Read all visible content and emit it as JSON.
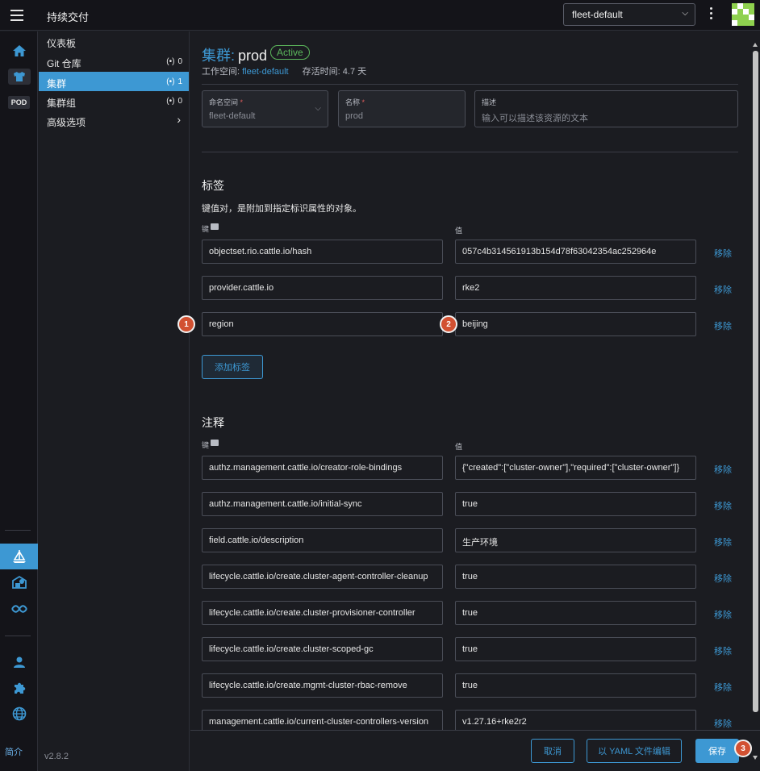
{
  "header": {
    "app_title": "持续交付",
    "workspace_value": "fleet-default"
  },
  "rail": {
    "pod_label": "POD",
    "bottom_link": "简介"
  },
  "nav": {
    "items": [
      {
        "label": "仪表板"
      },
      {
        "label": "Git 仓库",
        "count": "0"
      },
      {
        "label": "集群",
        "count": "1"
      },
      {
        "label": "集群组",
        "count": "0"
      },
      {
        "label": "高级选项"
      }
    ],
    "version": "v2.8.2"
  },
  "page": {
    "type_label": "集群:",
    "name": "prod",
    "status": "Active",
    "workspace_label": "工作空间:",
    "workspace_link": "fleet-default",
    "age_label": "存活时间:",
    "age_value": "4.7 天"
  },
  "form": {
    "namespace_label": "命名空间",
    "namespace_value": "fleet-default",
    "name_label": "名称",
    "name_value": "prod",
    "desc_label": "描述",
    "desc_placeholder": "输入可以描述该资源的文本"
  },
  "labels": {
    "title": "标签",
    "desc": "键值对，是附加到指定标识属性的对象。",
    "key_col": "键",
    "value_col": "值",
    "rows": [
      {
        "key": "objectset.rio.cattle.io/hash",
        "value": "057c4b314561913b154d78f63042354ac252964e"
      },
      {
        "key": "provider.cattle.io",
        "value": "rke2"
      },
      {
        "key": "region",
        "value": "beijing"
      }
    ],
    "remove_label": "移除",
    "add_button": "添加标签"
  },
  "annotations": {
    "title": "注释",
    "key_col": "键",
    "value_col": "值",
    "rows": [
      {
        "key": "authz.management.cattle.io/creator-role-bindings",
        "value": "{\"created\":[\"cluster-owner\"],\"required\":[\"cluster-owner\"]}"
      },
      {
        "key": "authz.management.cattle.io/initial-sync",
        "value": "true"
      },
      {
        "key": "field.cattle.io/description",
        "value": "生产环境"
      },
      {
        "key": "lifecycle.cattle.io/create.cluster-agent-controller-cleanup",
        "value": "true"
      },
      {
        "key": "lifecycle.cattle.io/create.cluster-provisioner-controller",
        "value": "true"
      },
      {
        "key": "lifecycle.cattle.io/create.cluster-scoped-gc",
        "value": "true"
      },
      {
        "key": "lifecycle.cattle.io/create.mgmt-cluster-rbac-remove",
        "value": "true"
      },
      {
        "key": "management.cattle.io/current-cluster-controllers-version",
        "value": "v1.27.16+rke2r2"
      }
    ],
    "remove_label": "移除"
  },
  "footer": {
    "cancel": "取消",
    "edit_yaml": "以 YAML 文件编辑",
    "save": "保存"
  },
  "markers": [
    "1",
    "2",
    "3"
  ],
  "colors": {
    "accent": "#3d98d3",
    "active_status": "#5cb85c",
    "marker": "#d25132"
  }
}
